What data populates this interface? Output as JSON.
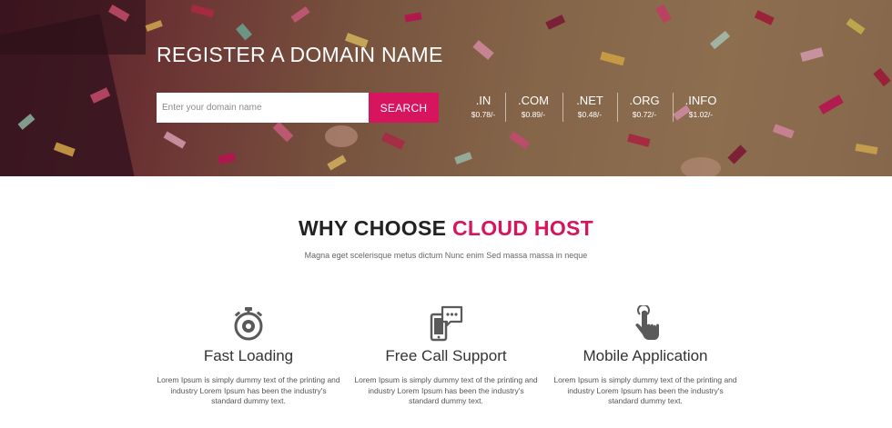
{
  "hero": {
    "title": "REGISTER A DOMAIN NAME",
    "search_placeholder": "Enter your domain name",
    "search_button": "SEARCH",
    "accent_color": "#d6155e",
    "tlds": [
      {
        "ext": ".IN",
        "price": "$0.78/-"
      },
      {
        "ext": ".COM",
        "price": "$0.89/-"
      },
      {
        "ext": ".NET",
        "price": "$0.48/-"
      },
      {
        "ext": ".ORG",
        "price": "$0.72/-"
      },
      {
        "ext": ".INFO",
        "price": "$1.02/-"
      }
    ]
  },
  "why": {
    "title_plain": "WHY CHOOSE ",
    "title_accent": "CLOUD HOST",
    "subtitle": "Magna eget scelerisque metus dictum Nunc enim Sed massa massa in neque"
  },
  "features": [
    {
      "icon": "stopwatch-icon",
      "title": "Fast Loading",
      "desc": "Lorem Ipsum is simply dummy text of the printing and industry Lorem Ipsum has been the industry's standard dummy text."
    },
    {
      "icon": "phone-chat-icon",
      "title": "Free Call Support",
      "desc": "Lorem Ipsum is simply dummy text of the printing and industry Lorem Ipsum has been the industry's standard dummy text."
    },
    {
      "icon": "touch-hand-icon",
      "title": "Mobile Application",
      "desc": "Lorem Ipsum is simply dummy text of the printing and industry Lorem Ipsum has been the industry's standard dummy text."
    }
  ]
}
